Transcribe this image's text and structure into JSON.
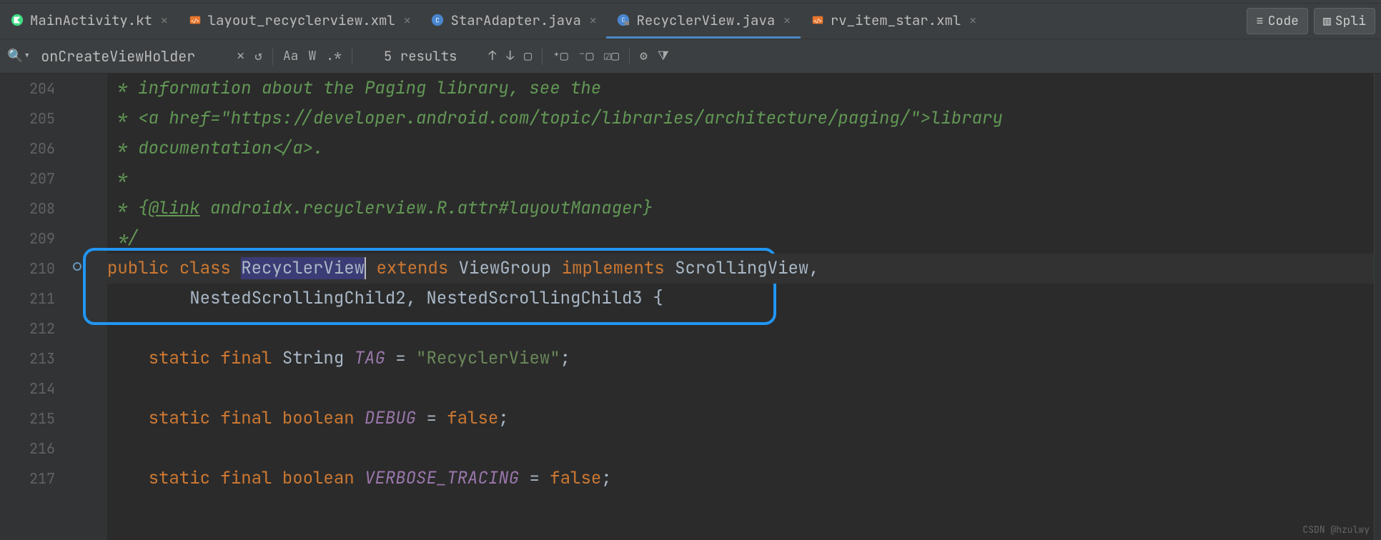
{
  "tabs": [
    {
      "icon": "kotlin",
      "label": "MainActivity.kt"
    },
    {
      "icon": "xml",
      "label": "layout_recyclerview.xml"
    },
    {
      "icon": "java",
      "label": "StarAdapter.java"
    },
    {
      "icon": "java-lock",
      "label": "RecyclerView.java",
      "active": true
    },
    {
      "icon": "xml",
      "label": "rv_item_star.xml"
    }
  ],
  "view_toggle": {
    "code": "Code",
    "split": "Spli"
  },
  "search": {
    "value": "onCreateViewHolder",
    "results": "5 results",
    "case_label": "Aa",
    "words_label": "W",
    "regex_label": ".*"
  },
  "gutter": {
    "lines": [
      "204",
      "205",
      "206",
      "207",
      "208",
      "209",
      "210",
      "211",
      "212",
      "213",
      "214",
      "215",
      "216",
      "217"
    ]
  },
  "code": {
    "l204": " * information about the Paging library, see the",
    "l205_pre": " * <a href=\"https://developer.android.com/topic/libraries/architecture/paging/\">",
    "l205_link": "library",
    "l206": " * documentation</a>.",
    "l207": " *",
    "l208_pre": " * {",
    "l208_link": "@link",
    "l208_post": " androidx.recyclerview.R.attr#layoutManager}",
    "l209": " */",
    "l210_public": "public",
    "l210_class": "class",
    "l210_name": "RecyclerView",
    "l210_extends": "extends",
    "l210_vg": "ViewGroup",
    "l210_impl": "implements",
    "l210_sv": "ScrollingView",
    "l211": "        NestedScrollingChild2, NestedScrollingChild3 {",
    "l213_static": "static",
    "l213_final": "final",
    "l213_string": "String",
    "l213_tag": "TAG",
    "l213_eq": " = ",
    "l213_val": "\"RecyclerView\"",
    "l213_semi": ";",
    "l215_static": "static",
    "l215_final": "final",
    "l215_bool": "boolean",
    "l215_debug": "DEBUG",
    "l215_eq": " = ",
    "l215_false": "false",
    "l215_semi": ";",
    "l217_static": "static",
    "l217_final": "final",
    "l217_bool": "boolean",
    "l217_vt": "VERBOSE_TRACING",
    "l217_eq": " = ",
    "l217_false": "false",
    "l217_semi": ";"
  },
  "watermark": "CSDN @hzulwy"
}
